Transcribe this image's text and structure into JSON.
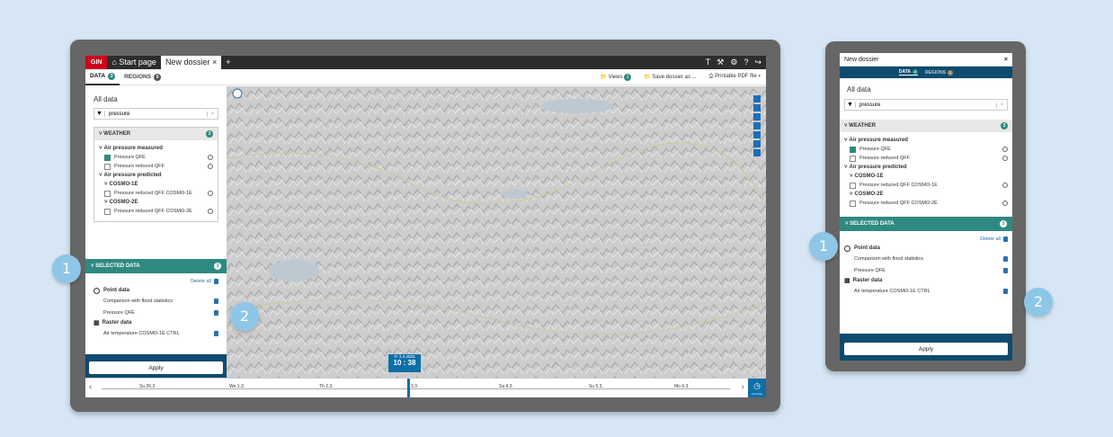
{
  "desktop": {
    "topbar": {
      "brand": "GIN",
      "tabs": [
        "Start page",
        "New dossier"
      ],
      "close": "×",
      "add": "+",
      "icons": [
        "T",
        "⚒",
        "⚙",
        "?",
        "↪"
      ]
    },
    "subtabs": [
      {
        "label": "DATA",
        "count": "3"
      },
      {
        "label": "REGIONS",
        "count": "0"
      }
    ],
    "actions": {
      "views": "Views",
      "views_count": "1",
      "save": "Save dossier as ...",
      "pdf": "Printable PDF file"
    },
    "panel": {
      "title": "All data",
      "search_value": "pressure",
      "search_clear": "×",
      "weather": {
        "label": "WEATHER",
        "count": "3"
      },
      "items": [
        {
          "type": "group",
          "label": "Air pressure measured"
        },
        {
          "type": "item",
          "label": "Pressure QFE",
          "checked": true
        },
        {
          "type": "item",
          "label": "Pressure reduced QFF",
          "checked": false
        },
        {
          "type": "group",
          "label": "Air pressure predicted"
        },
        {
          "type": "sub",
          "label": "COSMO-1E"
        },
        {
          "type": "item",
          "label": "Pressure reduced QFF COSMO-1E",
          "checked": false
        },
        {
          "type": "sub",
          "label": "COSMO-2E"
        },
        {
          "type": "item",
          "label": "Pressure reduced QFF COSMO-2E",
          "checked": false
        }
      ],
      "selected": {
        "label": "SELECTED DATA",
        "count": "3",
        "delete_all": "Delete all",
        "point_label": "Point data",
        "point_items": [
          "Comparison with flood statistics",
          "Pressure QFE"
        ],
        "raster_label": "Raster data",
        "raster_items": [
          "Air temperature COSMO-1E CTRL"
        ]
      },
      "apply": "Apply"
    },
    "timeline": {
      "date": "Fr 3.3.2023",
      "time": "10 : 38",
      "days": [
        "Su 26.2.",
        "We 1.3.",
        "Th 2.3.",
        "3.3.",
        "Sa 4.3.",
        "Su 5.3.",
        "Mo 6.3."
      ],
      "live": "Live time"
    }
  },
  "mobile": {
    "title": "New dossier",
    "close": "×",
    "tabs": [
      {
        "label": "DATA",
        "count": "3"
      },
      {
        "label": "REGIONS",
        "count": "0"
      }
    ],
    "panel_title": "All data",
    "search_value": "pressure",
    "weather_label": "WEATHER",
    "weather_count": "3",
    "selected_label": "SELECTED DATA",
    "selected_count": "3",
    "apply": "Apply"
  },
  "callouts": [
    "1",
    "2"
  ]
}
